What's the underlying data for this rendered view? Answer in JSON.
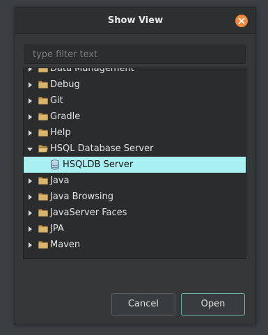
{
  "dialog": {
    "title": "Show View",
    "close_icon": "close-icon",
    "accent_color": "#f0883e"
  },
  "filter": {
    "placeholder": "type filter text",
    "value": ""
  },
  "tree": {
    "items": [
      {
        "label": "Data Management",
        "expanded": false,
        "icon": "folder-icon"
      },
      {
        "label": "Debug",
        "expanded": false,
        "icon": "folder-icon"
      },
      {
        "label": "Git",
        "expanded": false,
        "icon": "folder-icon"
      },
      {
        "label": "Gradle",
        "expanded": false,
        "icon": "folder-icon"
      },
      {
        "label": "Help",
        "expanded": false,
        "icon": "folder-icon"
      },
      {
        "label": "HSQL Database Server",
        "expanded": true,
        "icon": "folder-open-icon"
      },
      {
        "label": "HSQLDB Server",
        "child": true,
        "selected": true,
        "icon": "database-icon"
      },
      {
        "label": "Java",
        "expanded": false,
        "icon": "folder-icon"
      },
      {
        "label": "Java Browsing",
        "expanded": false,
        "icon": "folder-icon"
      },
      {
        "label": "JavaServer Faces",
        "expanded": false,
        "icon": "folder-icon"
      },
      {
        "label": "JPA",
        "expanded": false,
        "icon": "folder-icon"
      },
      {
        "label": "Maven",
        "expanded": false,
        "icon": "folder-icon"
      }
    ],
    "selection_color": "#a8f0f1"
  },
  "buttons": {
    "cancel_label": "Cancel",
    "open_label": "Open"
  }
}
